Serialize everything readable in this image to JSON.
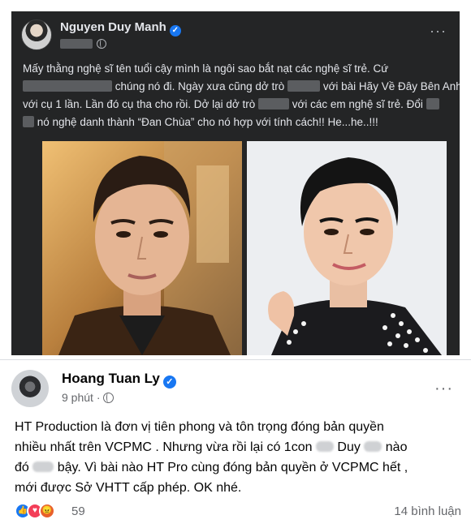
{
  "post1": {
    "author": "Nguyen Duy Manh",
    "more": "···",
    "text_lines": [
      [
        "Mấy thằng nghệ sĩ tên tuổi cậy mình là ngôi sao bắt nạt các nghệ sĩ trẻ. Cứ"
      ],
      [
        "",
        "chúng nó đi. Ngày xưa cũng dở trò",
        "với bài Hãy Về Đây Bên Anh"
      ],
      [
        "với cụ 1 lần. Lần đó cụ tha cho rồi. Dở lại dở trò",
        "với các em nghệ sĩ trẻ. Đổi"
      ],
      [
        "nó nghệ danh thành “Đan Chùa” cho nó hợp với tính cách!! He...he..!!!"
      ]
    ]
  },
  "post2": {
    "author": "Hoang Tuan Ly",
    "time": "9 phút ·",
    "more": "···",
    "text_lines": [
      "HT Production là đơn vị tiên phong và tôn trọng đóng bản quyền",
      "nhiều nhất trên VCPMC . Nhưng vừa rồi lại có 1con",
      "Duy",
      "nào",
      "đó",
      "bậy. Vì bài nào HT Pro cùng đóng bản quyền ở VCPMC hết ,",
      "mới được Sở VHTT cấp phép. OK nhé."
    ],
    "reaction_count": "59",
    "comments": "14 bình luận"
  },
  "colors": {
    "dark_bg": "#242526",
    "dark_text": "#e4e6eb",
    "verified": "#1877f2"
  }
}
